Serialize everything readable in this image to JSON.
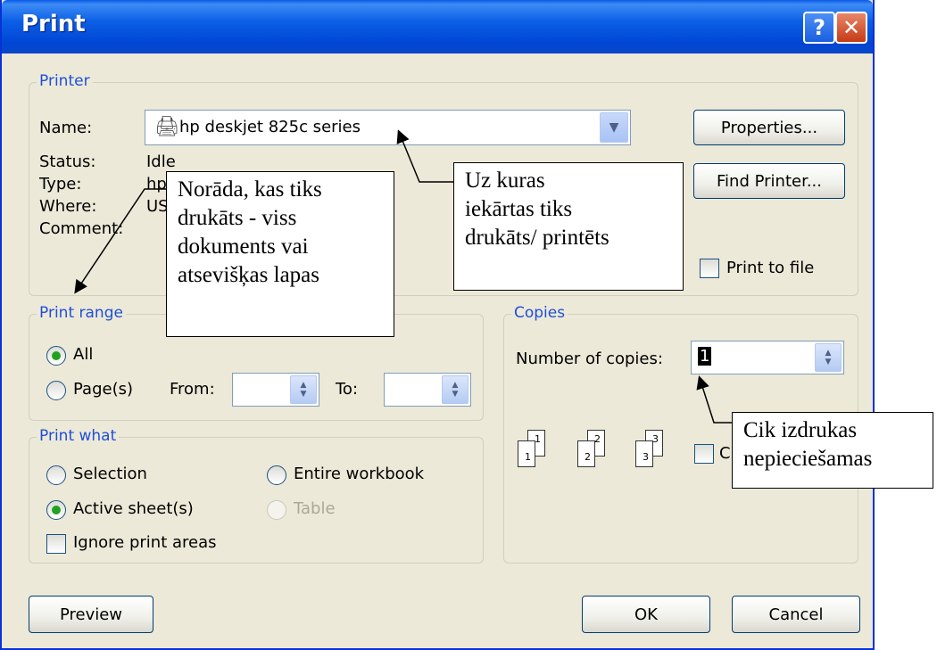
{
  "window": {
    "title": "Print",
    "help_label": "?",
    "close_label": "✕"
  },
  "printer": {
    "group_label": "Printer",
    "name_label": "Name:",
    "name_value": "hp deskjet 825c series",
    "status_label": "Status:",
    "status_value": "Idle",
    "type_label": "Type:",
    "type_value": "hp",
    "where_label": "Where:",
    "where_value": "US",
    "comment_label": "Comment:",
    "properties_label": "Properties...",
    "find_printer_label": "Find Printer...",
    "print_to_file_label": "Print to file"
  },
  "print_range": {
    "group_label": "Print range",
    "all_label": "All",
    "pages_label": "Page(s)",
    "from_label": "From:",
    "to_label": "To:",
    "selected": "All"
  },
  "print_what": {
    "group_label": "Print what",
    "selection_label": "Selection",
    "entire_workbook_label": "Entire workbook",
    "active_sheets_label": "Active sheet(s)",
    "table_label": "Table",
    "ignore_print_areas_label": "Ignore print areas",
    "selected": "Active sheet(s)"
  },
  "copies": {
    "group_label": "Copies",
    "number_label": "Number of copies:",
    "number_value": "1",
    "collate_label": "C",
    "page_icons": [
      {
        "back": "1",
        "front": "1"
      },
      {
        "back": "2",
        "front": "2"
      },
      {
        "back": "3",
        "front": "3"
      }
    ]
  },
  "buttons": {
    "preview_label": "Preview",
    "ok_label": "OK",
    "cancel_label": "Cancel"
  },
  "callouts": {
    "print_range_note": [
      "Norāda, kas tiks",
      "drukāts - viss",
      "dokuments vai",
      "atsevišķas lapas"
    ],
    "printer_note": [
      "Uz kuras",
      "iekārtas tiks",
      "drukāts/ printēts"
    ],
    "copies_note": [
      "Cik izdrukas",
      "nepieciešamas"
    ]
  },
  "colors": {
    "titlebar": "#0054e3",
    "dialog_bg": "#ece9d8",
    "group_label": "#1f4fd8",
    "radio_checked": "#21a121"
  }
}
